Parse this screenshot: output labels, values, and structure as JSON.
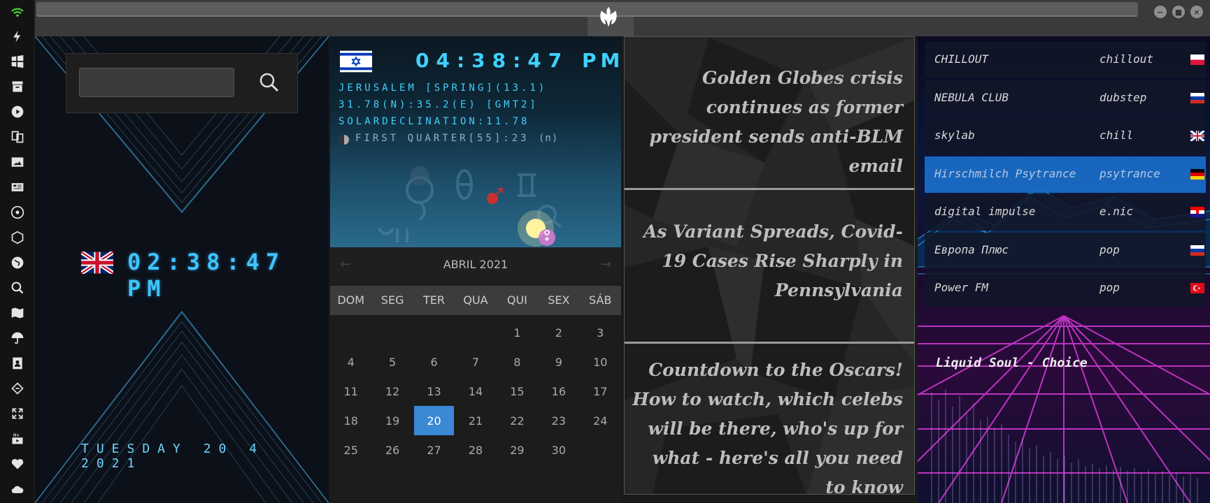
{
  "sidebar": {
    "icons": [
      "wifi-icon",
      "lightning-icon",
      "windows-icon",
      "archive-icon",
      "play-icon",
      "translate-icon",
      "image-icon",
      "news-icon",
      "atom-icon",
      "hex-icon",
      "globe-icon",
      "search-icon",
      "map-icon",
      "umbrella-icon",
      "contacts-icon",
      "ticket-icon",
      "expand-icon",
      "youtube-icon",
      "heart-icon",
      "cloud-icon"
    ]
  },
  "uk": {
    "time": "02:38:47 PM",
    "date": "TUESDAY 20 4 2021"
  },
  "search": {
    "value": "",
    "placeholder": ""
  },
  "israel": {
    "time": "04:38:47",
    "ampm": "PM",
    "line1": "JERUSALEM [SPRING](13.1)",
    "line2": "31.78(N):35.2(E) [GMT2]",
    "line3": "SOLARDECLINATION:11.78",
    "line4": "FIRST QUARTER[55]:23",
    "line4_suffix": "(n)"
  },
  "calendar": {
    "month": "ABRIL 2021",
    "days_of_week": [
      "DOM",
      "SEG",
      "TER",
      "QUA",
      "QUI",
      "SEX",
      "SÁB"
    ],
    "leading_blanks": 4,
    "days": [
      "1",
      "2",
      "3",
      "4",
      "5",
      "6",
      "7",
      "8",
      "9",
      "10",
      "11",
      "12",
      "13",
      "14",
      "15",
      "16",
      "17",
      "18",
      "19",
      "20",
      "21",
      "22",
      "23",
      "24",
      "25",
      "26",
      "27",
      "28",
      "29",
      "30"
    ],
    "today": "20"
  },
  "news": [
    {
      "title": "Golden Globes crisis continues as former president sends anti-BLM email"
    },
    {
      "title": "As Variant Spreads, Covid-19 Cases Rise Sharply in Pennsylvania"
    },
    {
      "title": "Countdown to the Oscars! How to watch, which celebs will be there, who's up for what - here's all you need to know"
    }
  ],
  "radio": {
    "stations": [
      {
        "name": "CHILLOUT",
        "genre": "chillout",
        "flag": "poland"
      },
      {
        "name": "NEBULA CLUB",
        "genre": "dubstep",
        "flag": "russia"
      },
      {
        "name": "skylab",
        "genre": "chill",
        "flag": "uk"
      },
      {
        "name": "Hirschmilch Psytrance",
        "genre": "psytrance",
        "flag": "germany"
      },
      {
        "name": "digital impulse",
        "genre": "e.nic",
        "flag": "croatia"
      },
      {
        "name": "Европа Плюс",
        "genre": "pop",
        "flag": "russia"
      },
      {
        "name": "Power FM",
        "genre": "pop",
        "flag": "turkey"
      }
    ],
    "selected_index": 3,
    "now_playing": "Liquid Soul - Choice"
  },
  "colors": {
    "accent": "#3fc4ff",
    "calendar_today": "#3b88d4",
    "selected_station": "#1a6ec8"
  }
}
